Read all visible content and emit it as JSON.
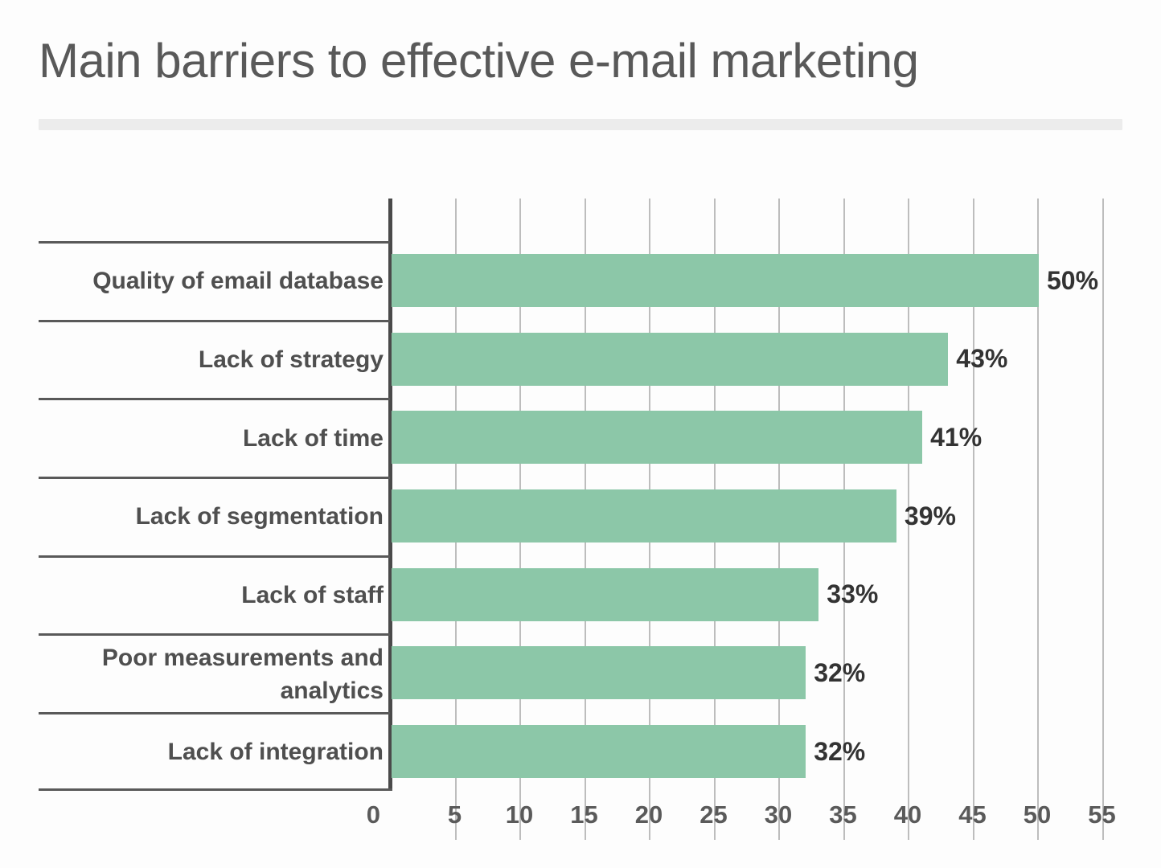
{
  "chart_data": {
    "type": "bar",
    "orientation": "horizontal",
    "title": "Main barriers to effective e-mail marketing",
    "xlabel": "",
    "ylabel": "",
    "xlim": [
      0,
      57
    ],
    "grid": true,
    "legend": false,
    "value_suffix": "%",
    "bar_color": "#8cc7a8",
    "categories": [
      "Quality of email database",
      "Lack of strategy",
      "Lack of time",
      "Lack of segmentation",
      "Lack of staff",
      "Poor measurements and\nanalytics",
      "Lack of integration"
    ],
    "values": [
      50,
      43,
      41,
      39,
      33,
      32,
      32
    ],
    "value_labels": [
      "50%",
      "43%",
      "41%",
      "39%",
      "33%",
      "32%",
      "32%"
    ],
    "xticks": [
      0,
      5,
      10,
      15,
      20,
      25,
      30,
      35,
      40,
      45,
      50,
      55
    ],
    "xtick_labels": [
      "0",
      "5",
      "10",
      "15",
      "20",
      "25",
      "30",
      "35",
      "40",
      "45",
      "50",
      "55"
    ]
  },
  "colors": {
    "bar": "#8cc7a8",
    "title_text": "#595959",
    "label_text": "#4f4f4f",
    "axis_line": "#4a4a4a",
    "gridline": "#bdbdbd",
    "divider": "#ececec",
    "background": "#fdfdfd"
  }
}
